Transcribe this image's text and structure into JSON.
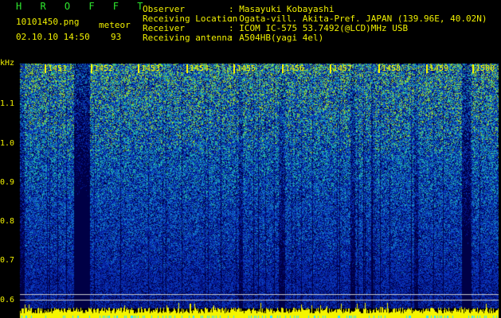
{
  "header": {
    "program": "H R O F F T",
    "filename": "10101450.png",
    "datetime": "02.10.10 14:50",
    "meteor_label": "meteor",
    "meteor_count": "93",
    "fields": [
      {
        "label": "Observer",
        "value": ": Masayuki Kobayashi"
      },
      {
        "label": "Receiving Location",
        "value": ": Ogata-vill. Akita-Pref. JAPAN (139.96E, 40.02N)"
      },
      {
        "label": "Receiver",
        "value": ": ICOM IC-575 53.7492(@LCD)MHz USB"
      },
      {
        "label": "Receiving antenna",
        "value": ": A504HB(yagi 4el)"
      }
    ]
  },
  "spectrogram": {
    "y_unit": "kHz",
    "y_ticks": [
      "1.1",
      "1.0",
      "0.9",
      "0.8",
      "0.7",
      "0.6"
    ],
    "x_ticks": [
      "1451",
      "1452",
      "1453",
      "1454",
      "1455",
      "1456",
      "1457",
      "1458",
      "1459",
      "1500"
    ]
  },
  "colors": {
    "header_green": "#2ee82e",
    "header_yellow": "#f0f000",
    "background": "#000000"
  }
}
